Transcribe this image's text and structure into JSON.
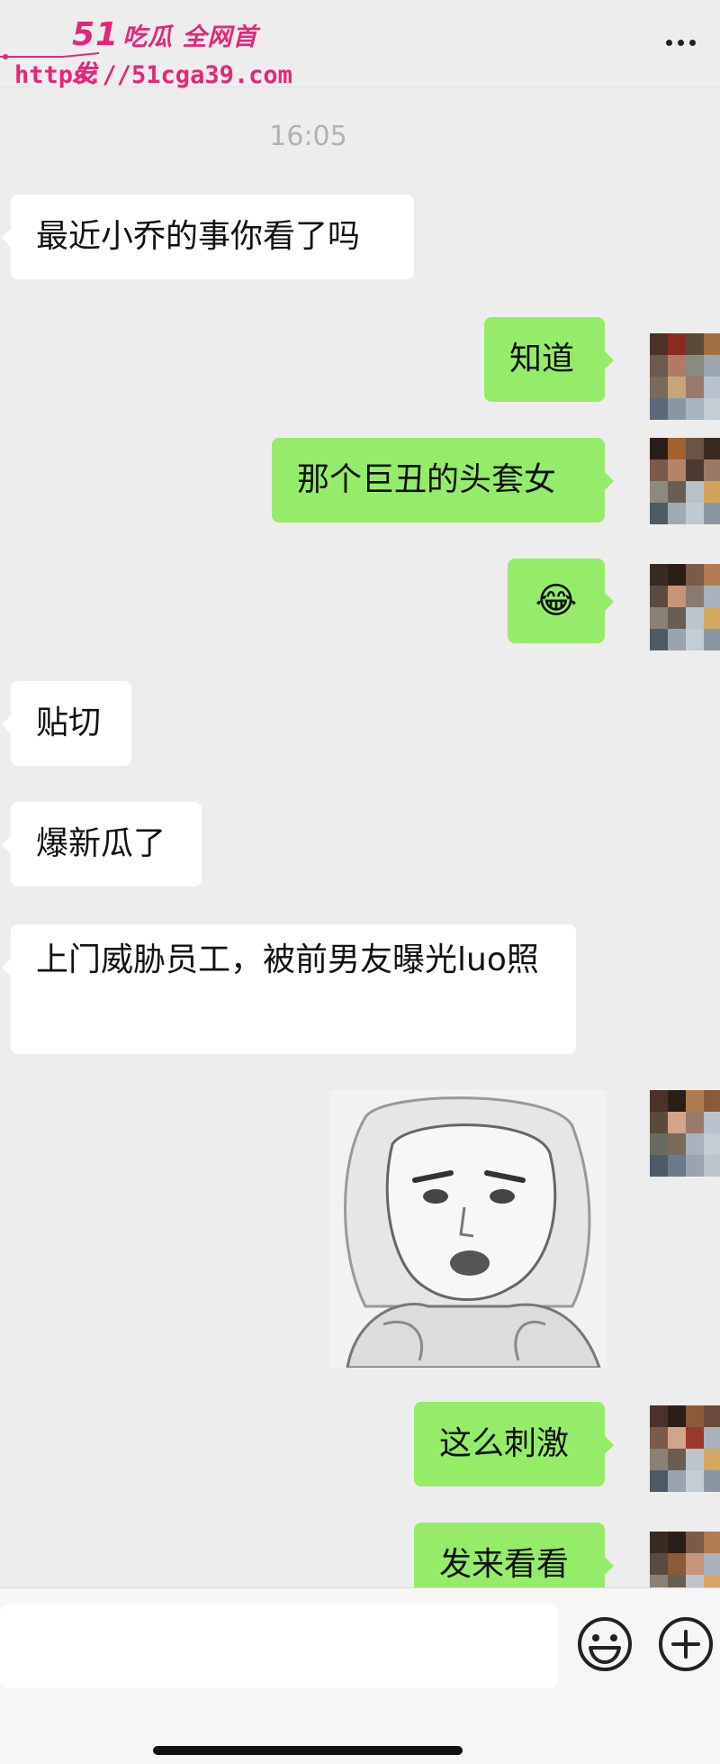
{
  "watermark": {
    "line1": "51",
    "line1_small": "吃瓜 全网首发",
    "line2": "https://51cga39.com"
  },
  "timestamp": "16:05",
  "messages": [
    {
      "side": "left",
      "text": "最近小乔的事你看了吗"
    },
    {
      "side": "right",
      "text": "知道"
    },
    {
      "side": "right",
      "text": "那个巨丑的头套女"
    },
    {
      "side": "right",
      "text": "😂"
    },
    {
      "side": "left",
      "text": "贴切"
    },
    {
      "side": "left",
      "text": "爆新瓜了"
    },
    {
      "side": "left",
      "text": "上门威胁员工，被前男友曝光luo照"
    },
    {
      "side": "right",
      "text": "这么刺激"
    },
    {
      "side": "right",
      "text": "发来看看"
    }
  ],
  "icons": {
    "more": "more-dots-icon",
    "emoji": "smiley-icon",
    "plus": "plus-circle-icon"
  },
  "colors": {
    "accent_green": "#95ec69",
    "watermark_pink": "#e8247a",
    "background": "#ededed"
  }
}
